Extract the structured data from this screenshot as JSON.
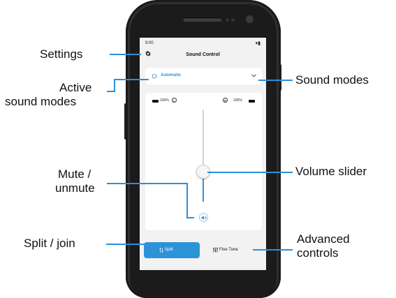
{
  "screen": {
    "status_time": "9:00",
    "status_icons": "▾▮",
    "title": "Sound Control",
    "active_mode": "Automatic",
    "left_battery": "100%",
    "left_side": "L",
    "right_side": "R",
    "right_battery": "100%",
    "volume_level_fraction": 0.4,
    "split_label": "Split",
    "fine_tune_label": "Fine Tune"
  },
  "callouts": {
    "settings": "Settings",
    "active_modes_line1": "Active",
    "active_modes_line2": "sound modes",
    "mute_line1": "Mute /",
    "mute_line2": "unmute",
    "split_join": "Split / join",
    "sound_modes": "Sound modes",
    "volume_slider": "Volume slider",
    "advanced_line1": "Advanced",
    "advanced_line2": "controls"
  },
  "icons": {
    "gear": "gear-icon",
    "mode": "power-cycle-icon",
    "chevron": "chevron-down-icon",
    "speaker": "speaker-icon",
    "split": "split-arrows-icon",
    "fine_tune": "sliders-icon"
  },
  "colors": {
    "accent": "#2e8ed6",
    "phone": "#2f2f31",
    "screen_bg": "#f2f2f3"
  }
}
